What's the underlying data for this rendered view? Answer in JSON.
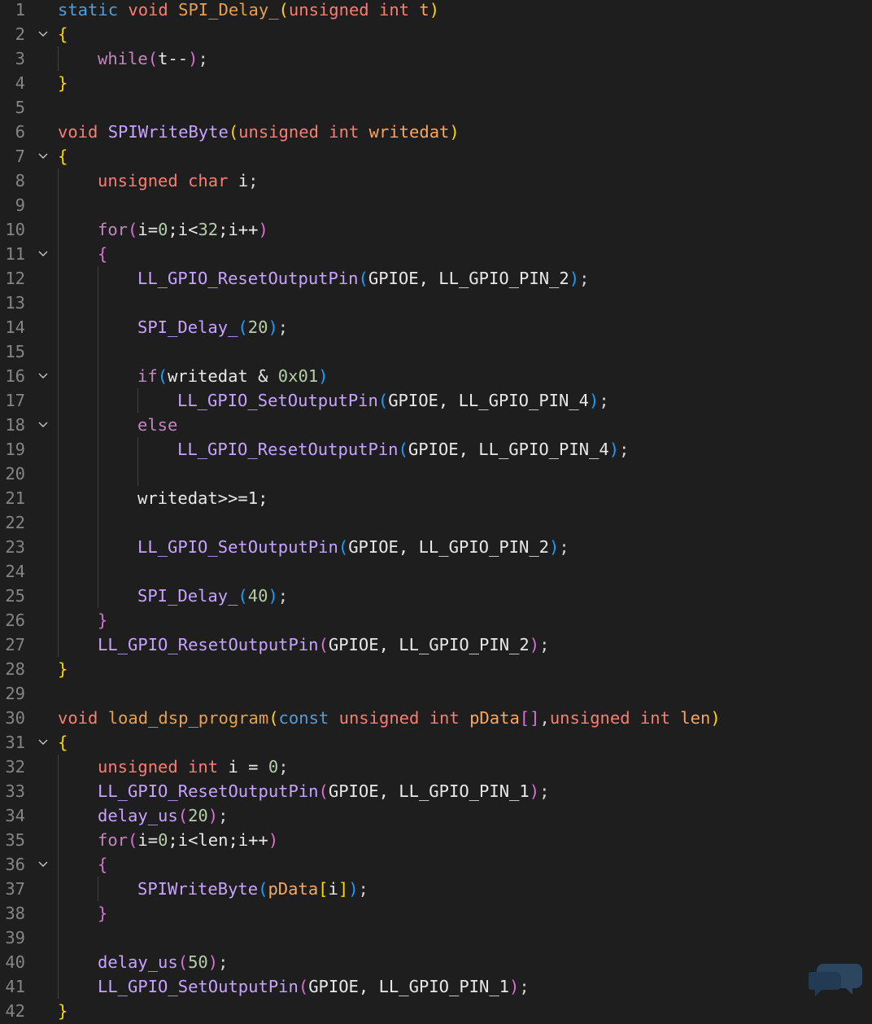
{
  "editor": {
    "language": "C",
    "colors": {
      "background": "#1e1e1e",
      "line_number": "#858585",
      "keyword": "#569cd6",
      "control": "#c586c0",
      "type": "#f97e72",
      "function": "#c8a2ff",
      "parameter": "#f9a760",
      "number": "#b5cea8",
      "bracket_level_1": "#ffd700",
      "bracket_level_2": "#da70d6",
      "bracket_level_3": "#179fff"
    },
    "fold_icon": "chevron-down-icon",
    "lines": [
      {
        "n": "1",
        "fold": false,
        "indent": 0,
        "tokens": [
          [
            "static",
            "kw"
          ],
          [
            " ",
            "pn"
          ],
          [
            "void",
            "type"
          ],
          [
            " ",
            "pn"
          ],
          [
            "SPI_Delay_",
            "fn2"
          ],
          [
            "(",
            "b1"
          ],
          [
            "unsigned",
            "type"
          ],
          [
            " ",
            "pn"
          ],
          [
            "int",
            "type"
          ],
          [
            " ",
            "pn"
          ],
          [
            "t",
            "prm"
          ],
          [
            ")",
            "b1"
          ]
        ]
      },
      {
        "n": "2",
        "fold": true,
        "indent": 0,
        "tokens": [
          [
            "{",
            "b1"
          ]
        ]
      },
      {
        "n": "3",
        "fold": false,
        "indent": 1,
        "tokens": [
          [
            "while",
            "ctl"
          ],
          [
            "(",
            "b2"
          ],
          [
            "t--",
            "var"
          ],
          [
            ")",
            "b2"
          ],
          [
            ";",
            "pn"
          ]
        ]
      },
      {
        "n": "4",
        "fold": false,
        "indent": 0,
        "tokens": [
          [
            "}",
            "b1"
          ]
        ]
      },
      {
        "n": "5",
        "fold": false,
        "indent": 0,
        "tokens": []
      },
      {
        "n": "6",
        "fold": false,
        "indent": 0,
        "tokens": [
          [
            "void",
            "type"
          ],
          [
            " ",
            "pn"
          ],
          [
            "SPIWriteByte",
            "fn"
          ],
          [
            "(",
            "b1"
          ],
          [
            "unsigned",
            "type"
          ],
          [
            " ",
            "pn"
          ],
          [
            "int",
            "type"
          ],
          [
            " ",
            "pn"
          ],
          [
            "writedat",
            "prm"
          ],
          [
            ")",
            "b1"
          ]
        ]
      },
      {
        "n": "7",
        "fold": true,
        "indent": 0,
        "tokens": [
          [
            "{",
            "b1"
          ]
        ]
      },
      {
        "n": "8",
        "fold": false,
        "indent": 1,
        "tokens": [
          [
            "unsigned",
            "type"
          ],
          [
            " ",
            "pn"
          ],
          [
            "char",
            "type"
          ],
          [
            " ",
            "pn"
          ],
          [
            "i",
            "var"
          ],
          [
            ";",
            "pn"
          ]
        ]
      },
      {
        "n": "9",
        "fold": false,
        "indent": 1,
        "tokens": []
      },
      {
        "n": "10",
        "fold": false,
        "indent": 1,
        "tokens": [
          [
            "for",
            "ctl"
          ],
          [
            "(",
            "b2"
          ],
          [
            "i=",
            "var"
          ],
          [
            "0",
            "num"
          ],
          [
            ";i<",
            "var"
          ],
          [
            "32",
            "num"
          ],
          [
            ";i++",
            "var"
          ],
          [
            ")",
            "b2"
          ]
        ]
      },
      {
        "n": "11",
        "fold": true,
        "indent": 1,
        "tokens": [
          [
            "{",
            "b2"
          ]
        ]
      },
      {
        "n": "12",
        "fold": false,
        "indent": 2,
        "tokens": [
          [
            "LL_GPIO_ResetOutputPin",
            "fn"
          ],
          [
            "(",
            "b3"
          ],
          [
            "GPIOE, LL_GPIO_PIN_2",
            "var"
          ],
          [
            ")",
            "b3"
          ],
          [
            ";",
            "pn"
          ]
        ]
      },
      {
        "n": "13",
        "fold": false,
        "indent": 2,
        "tokens": []
      },
      {
        "n": "14",
        "fold": false,
        "indent": 2,
        "tokens": [
          [
            "SPI_Delay_",
            "fn"
          ],
          [
            "(",
            "b3"
          ],
          [
            "20",
            "num"
          ],
          [
            ")",
            "b3"
          ],
          [
            ";",
            "pn"
          ]
        ]
      },
      {
        "n": "15",
        "fold": false,
        "indent": 2,
        "tokens": []
      },
      {
        "n": "16",
        "fold": true,
        "indent": 2,
        "tokens": [
          [
            "if",
            "ctl"
          ],
          [
            "(",
            "b3"
          ],
          [
            "writedat & ",
            "var"
          ],
          [
            "0x01",
            "num"
          ],
          [
            ")",
            "b3"
          ]
        ]
      },
      {
        "n": "17",
        "fold": false,
        "indent": 3,
        "tokens": [
          [
            "LL_GPIO_SetOutputPin",
            "fn"
          ],
          [
            "(",
            "b3"
          ],
          [
            "GPIOE, LL_GPIO_PIN_4",
            "var"
          ],
          [
            ")",
            "b3"
          ],
          [
            ";",
            "pn"
          ]
        ]
      },
      {
        "n": "18",
        "fold": true,
        "indent": 2,
        "tokens": [
          [
            "else",
            "ctl"
          ]
        ]
      },
      {
        "n": "19",
        "fold": false,
        "indent": 3,
        "tokens": [
          [
            "LL_GPIO_ResetOutputPin",
            "fn"
          ],
          [
            "(",
            "b3"
          ],
          [
            "GPIOE, LL_GPIO_PIN_4",
            "var"
          ],
          [
            ")",
            "b3"
          ],
          [
            ";",
            "pn"
          ]
        ]
      },
      {
        "n": "20",
        "fold": false,
        "indent": 3,
        "tokens": []
      },
      {
        "n": "21",
        "fold": false,
        "indent": 2,
        "tokens": [
          [
            "writedat>>=1;",
            "var"
          ]
        ]
      },
      {
        "n": "22",
        "fold": false,
        "indent": 2,
        "tokens": []
      },
      {
        "n": "23",
        "fold": false,
        "indent": 2,
        "tokens": [
          [
            "LL_GPIO_SetOutputPin",
            "fn"
          ],
          [
            "(",
            "b3"
          ],
          [
            "GPIOE, LL_GPIO_PIN_2",
            "var"
          ],
          [
            ")",
            "b3"
          ],
          [
            ";",
            "pn"
          ]
        ]
      },
      {
        "n": "24",
        "fold": false,
        "indent": 2,
        "tokens": []
      },
      {
        "n": "25",
        "fold": false,
        "indent": 2,
        "tokens": [
          [
            "SPI_Delay_",
            "fn"
          ],
          [
            "(",
            "b3"
          ],
          [
            "40",
            "num"
          ],
          [
            ")",
            "b3"
          ],
          [
            ";",
            "pn"
          ]
        ]
      },
      {
        "n": "26",
        "fold": false,
        "indent": 1,
        "tokens": [
          [
            "}",
            "b2"
          ]
        ]
      },
      {
        "n": "27",
        "fold": false,
        "indent": 1,
        "tokens": [
          [
            "LL_GPIO_ResetOutputPin",
            "fn"
          ],
          [
            "(",
            "b2"
          ],
          [
            "GPIOE, LL_GPIO_PIN_2",
            "var"
          ],
          [
            ")",
            "b2"
          ],
          [
            ";",
            "pn"
          ]
        ]
      },
      {
        "n": "28",
        "fold": false,
        "indent": 0,
        "tokens": [
          [
            "}",
            "b1"
          ]
        ]
      },
      {
        "n": "29",
        "fold": false,
        "indent": 0,
        "tokens": []
      },
      {
        "n": "30",
        "fold": false,
        "indent": 0,
        "tokens": [
          [
            "void",
            "type"
          ],
          [
            " ",
            "pn"
          ],
          [
            "load_dsp_program",
            "fn2"
          ],
          [
            "(",
            "b1"
          ],
          [
            "const",
            "kw"
          ],
          [
            " ",
            "pn"
          ],
          [
            "unsigned",
            "type"
          ],
          [
            " ",
            "pn"
          ],
          [
            "int",
            "type"
          ],
          [
            " ",
            "pn"
          ],
          [
            "pData",
            "prm"
          ],
          [
            "[]",
            "b2"
          ],
          [
            ",",
            "pn"
          ],
          [
            "unsigned",
            "type"
          ],
          [
            " ",
            "pn"
          ],
          [
            "int",
            "type"
          ],
          [
            " ",
            "pn"
          ],
          [
            "len",
            "prm"
          ],
          [
            ")",
            "b1"
          ]
        ]
      },
      {
        "n": "31",
        "fold": true,
        "indent": 0,
        "tokens": [
          [
            "{",
            "b1"
          ]
        ]
      },
      {
        "n": "32",
        "fold": false,
        "indent": 1,
        "tokens": [
          [
            "unsigned",
            "type"
          ],
          [
            " ",
            "pn"
          ],
          [
            "int",
            "type"
          ],
          [
            " ",
            "pn"
          ],
          [
            "i = ",
            "var"
          ],
          [
            "0",
            "num"
          ],
          [
            ";",
            "pn"
          ]
        ]
      },
      {
        "n": "33",
        "fold": false,
        "indent": 1,
        "tokens": [
          [
            "LL_GPIO_ResetOutputPin",
            "fn"
          ],
          [
            "(",
            "b2"
          ],
          [
            "GPIOE, LL_GPIO_PIN_1",
            "var"
          ],
          [
            ")",
            "b2"
          ],
          [
            ";",
            "pn"
          ]
        ]
      },
      {
        "n": "34",
        "fold": false,
        "indent": 1,
        "tokens": [
          [
            "delay_us",
            "fn"
          ],
          [
            "(",
            "b2"
          ],
          [
            "20",
            "num"
          ],
          [
            ")",
            "b2"
          ],
          [
            ";",
            "pn"
          ]
        ]
      },
      {
        "n": "35",
        "fold": false,
        "indent": 1,
        "tokens": [
          [
            "for",
            "ctl"
          ],
          [
            "(",
            "b2"
          ],
          [
            "i=",
            "var"
          ],
          [
            "0",
            "num"
          ],
          [
            ";i<len;i++",
            "var"
          ],
          [
            ")",
            "b2"
          ]
        ]
      },
      {
        "n": "36",
        "fold": true,
        "indent": 1,
        "tokens": [
          [
            "{",
            "b2"
          ]
        ]
      },
      {
        "n": "37",
        "fold": false,
        "indent": 2,
        "tokens": [
          [
            "SPIWriteByte",
            "fn"
          ],
          [
            "(",
            "b3"
          ],
          [
            "pData",
            "prm"
          ],
          [
            "[",
            "b1"
          ],
          [
            "i",
            "var"
          ],
          [
            "]",
            "b1"
          ],
          [
            ")",
            "b3"
          ],
          [
            ";",
            "pn"
          ]
        ]
      },
      {
        "n": "38",
        "fold": false,
        "indent": 1,
        "tokens": [
          [
            "}",
            "b2"
          ]
        ]
      },
      {
        "n": "39",
        "fold": false,
        "indent": 1,
        "tokens": []
      },
      {
        "n": "40",
        "fold": false,
        "indent": 1,
        "tokens": [
          [
            "delay_us",
            "fn"
          ],
          [
            "(",
            "b2"
          ],
          [
            "50",
            "num"
          ],
          [
            ")",
            "b2"
          ],
          [
            ";",
            "pn"
          ]
        ]
      },
      {
        "n": "41",
        "fold": false,
        "indent": 1,
        "tokens": [
          [
            "LL_GPIO_SetOutputPin",
            "fn"
          ],
          [
            "(",
            "b2"
          ],
          [
            "GPIOE, LL_GPIO_PIN_1",
            "var"
          ],
          [
            ")",
            "b2"
          ],
          [
            ";",
            "pn"
          ]
        ]
      },
      {
        "n": "42",
        "fold": false,
        "indent": 0,
        "tokens": [
          [
            "}",
            "b1"
          ]
        ]
      }
    ]
  }
}
